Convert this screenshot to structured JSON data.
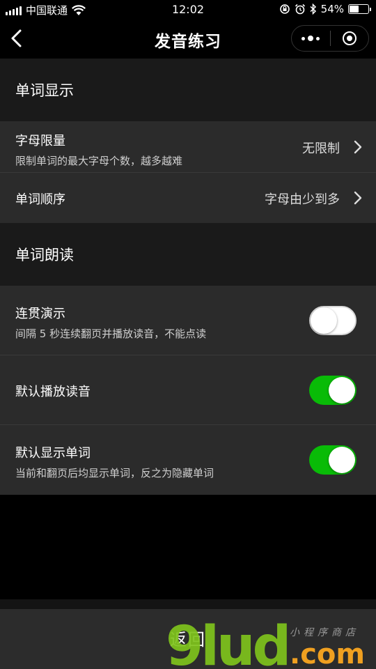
{
  "status_bar": {
    "carrier": "中国联通",
    "time": "12:02",
    "battery_percent": "54%",
    "battery_level": 0.54
  },
  "nav": {
    "title": "发音练习"
  },
  "sections": {
    "display_header": "单词显示",
    "letter_limit": {
      "title": "字母限量",
      "subtitle": "限制单词的最大字母个数，越多越难",
      "value": "无限制"
    },
    "word_order": {
      "title": "单词顺序",
      "value": "字母由少到多"
    },
    "reading_header": "单词朗读",
    "continuous_demo": {
      "title": "连贯演示",
      "subtitle": "间隔 5 秒连续翻页并播放读音，不能点读",
      "on": false
    },
    "default_audio": {
      "title": "默认播放读音",
      "on": true
    },
    "default_show": {
      "title": "默认显示单词",
      "subtitle": "当前和翻页后均显示单词，反之为隐藏单词",
      "on": true
    }
  },
  "bottom": {
    "return_label": "返回"
  },
  "watermark": {
    "main": "9lud",
    "suffix": ".com",
    "tagline": "小程序商店"
  },
  "colors": {
    "toggle_on": "#09bb07",
    "watermark_green": "#7fc31c",
    "watermark_orange": "#f0a020"
  }
}
